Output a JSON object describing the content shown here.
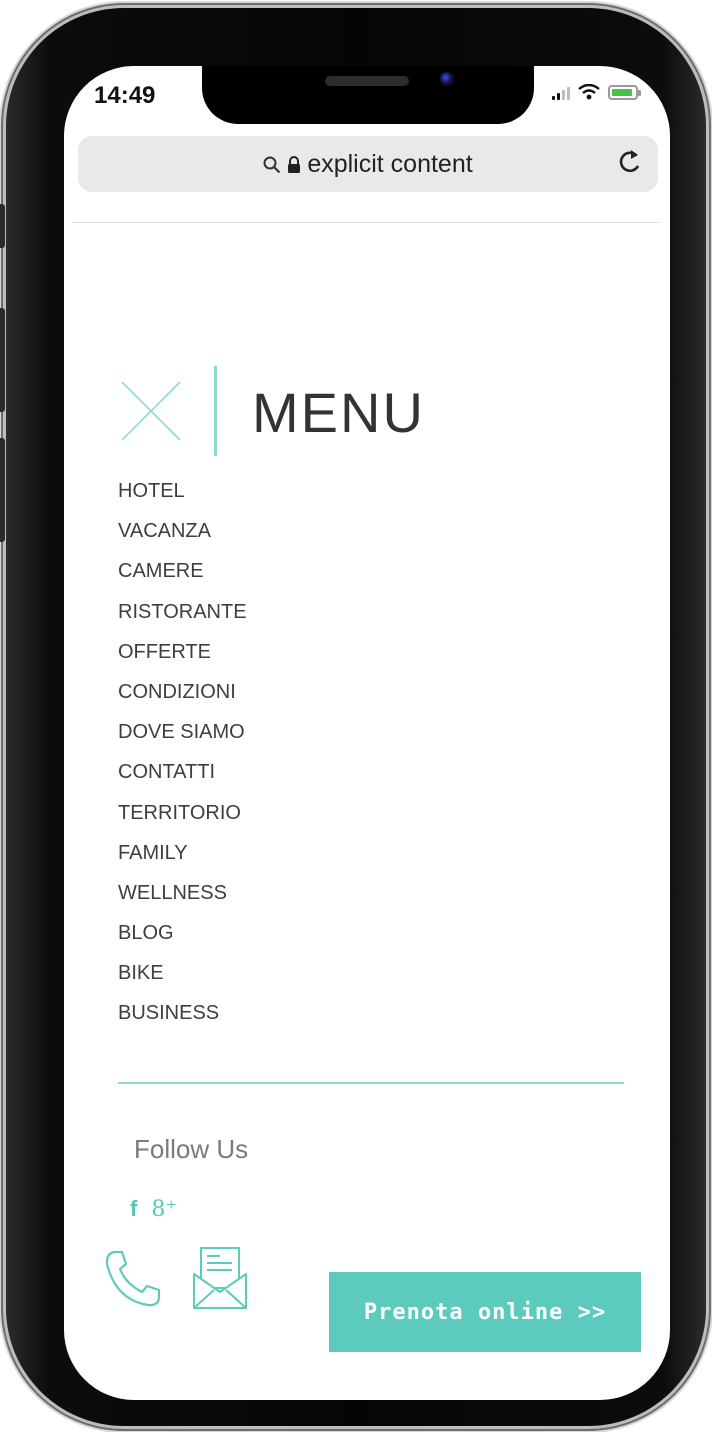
{
  "status": {
    "time": "14:49"
  },
  "browser": {
    "url": "explicit content"
  },
  "menu": {
    "title": "MENU",
    "items": [
      "HOTEL",
      "VACANZA",
      "CAMERE",
      "RISTORANTE",
      "OFFERTE",
      "CONDIZIONI",
      "DOVE SIAMO",
      "CONTATTI",
      "TERRITORIO",
      "FAMILY",
      "WELLNESS",
      "BLOG",
      "BIKE",
      "BUSINESS"
    ]
  },
  "social": {
    "heading": "Follow Us",
    "facebook": "f",
    "google_plus": "8⁺"
  },
  "cta": {
    "label": "Prenota online >>"
  },
  "colors": {
    "accent": "#5ccbbd",
    "accent_light": "#8fd9cc",
    "text": "#3e3e3e"
  },
  "icons": [
    "close-x-icon",
    "search-icon",
    "lock-icon",
    "reload-icon",
    "phone-icon",
    "mail-icon",
    "facebook-icon",
    "google-plus-icon"
  ]
}
